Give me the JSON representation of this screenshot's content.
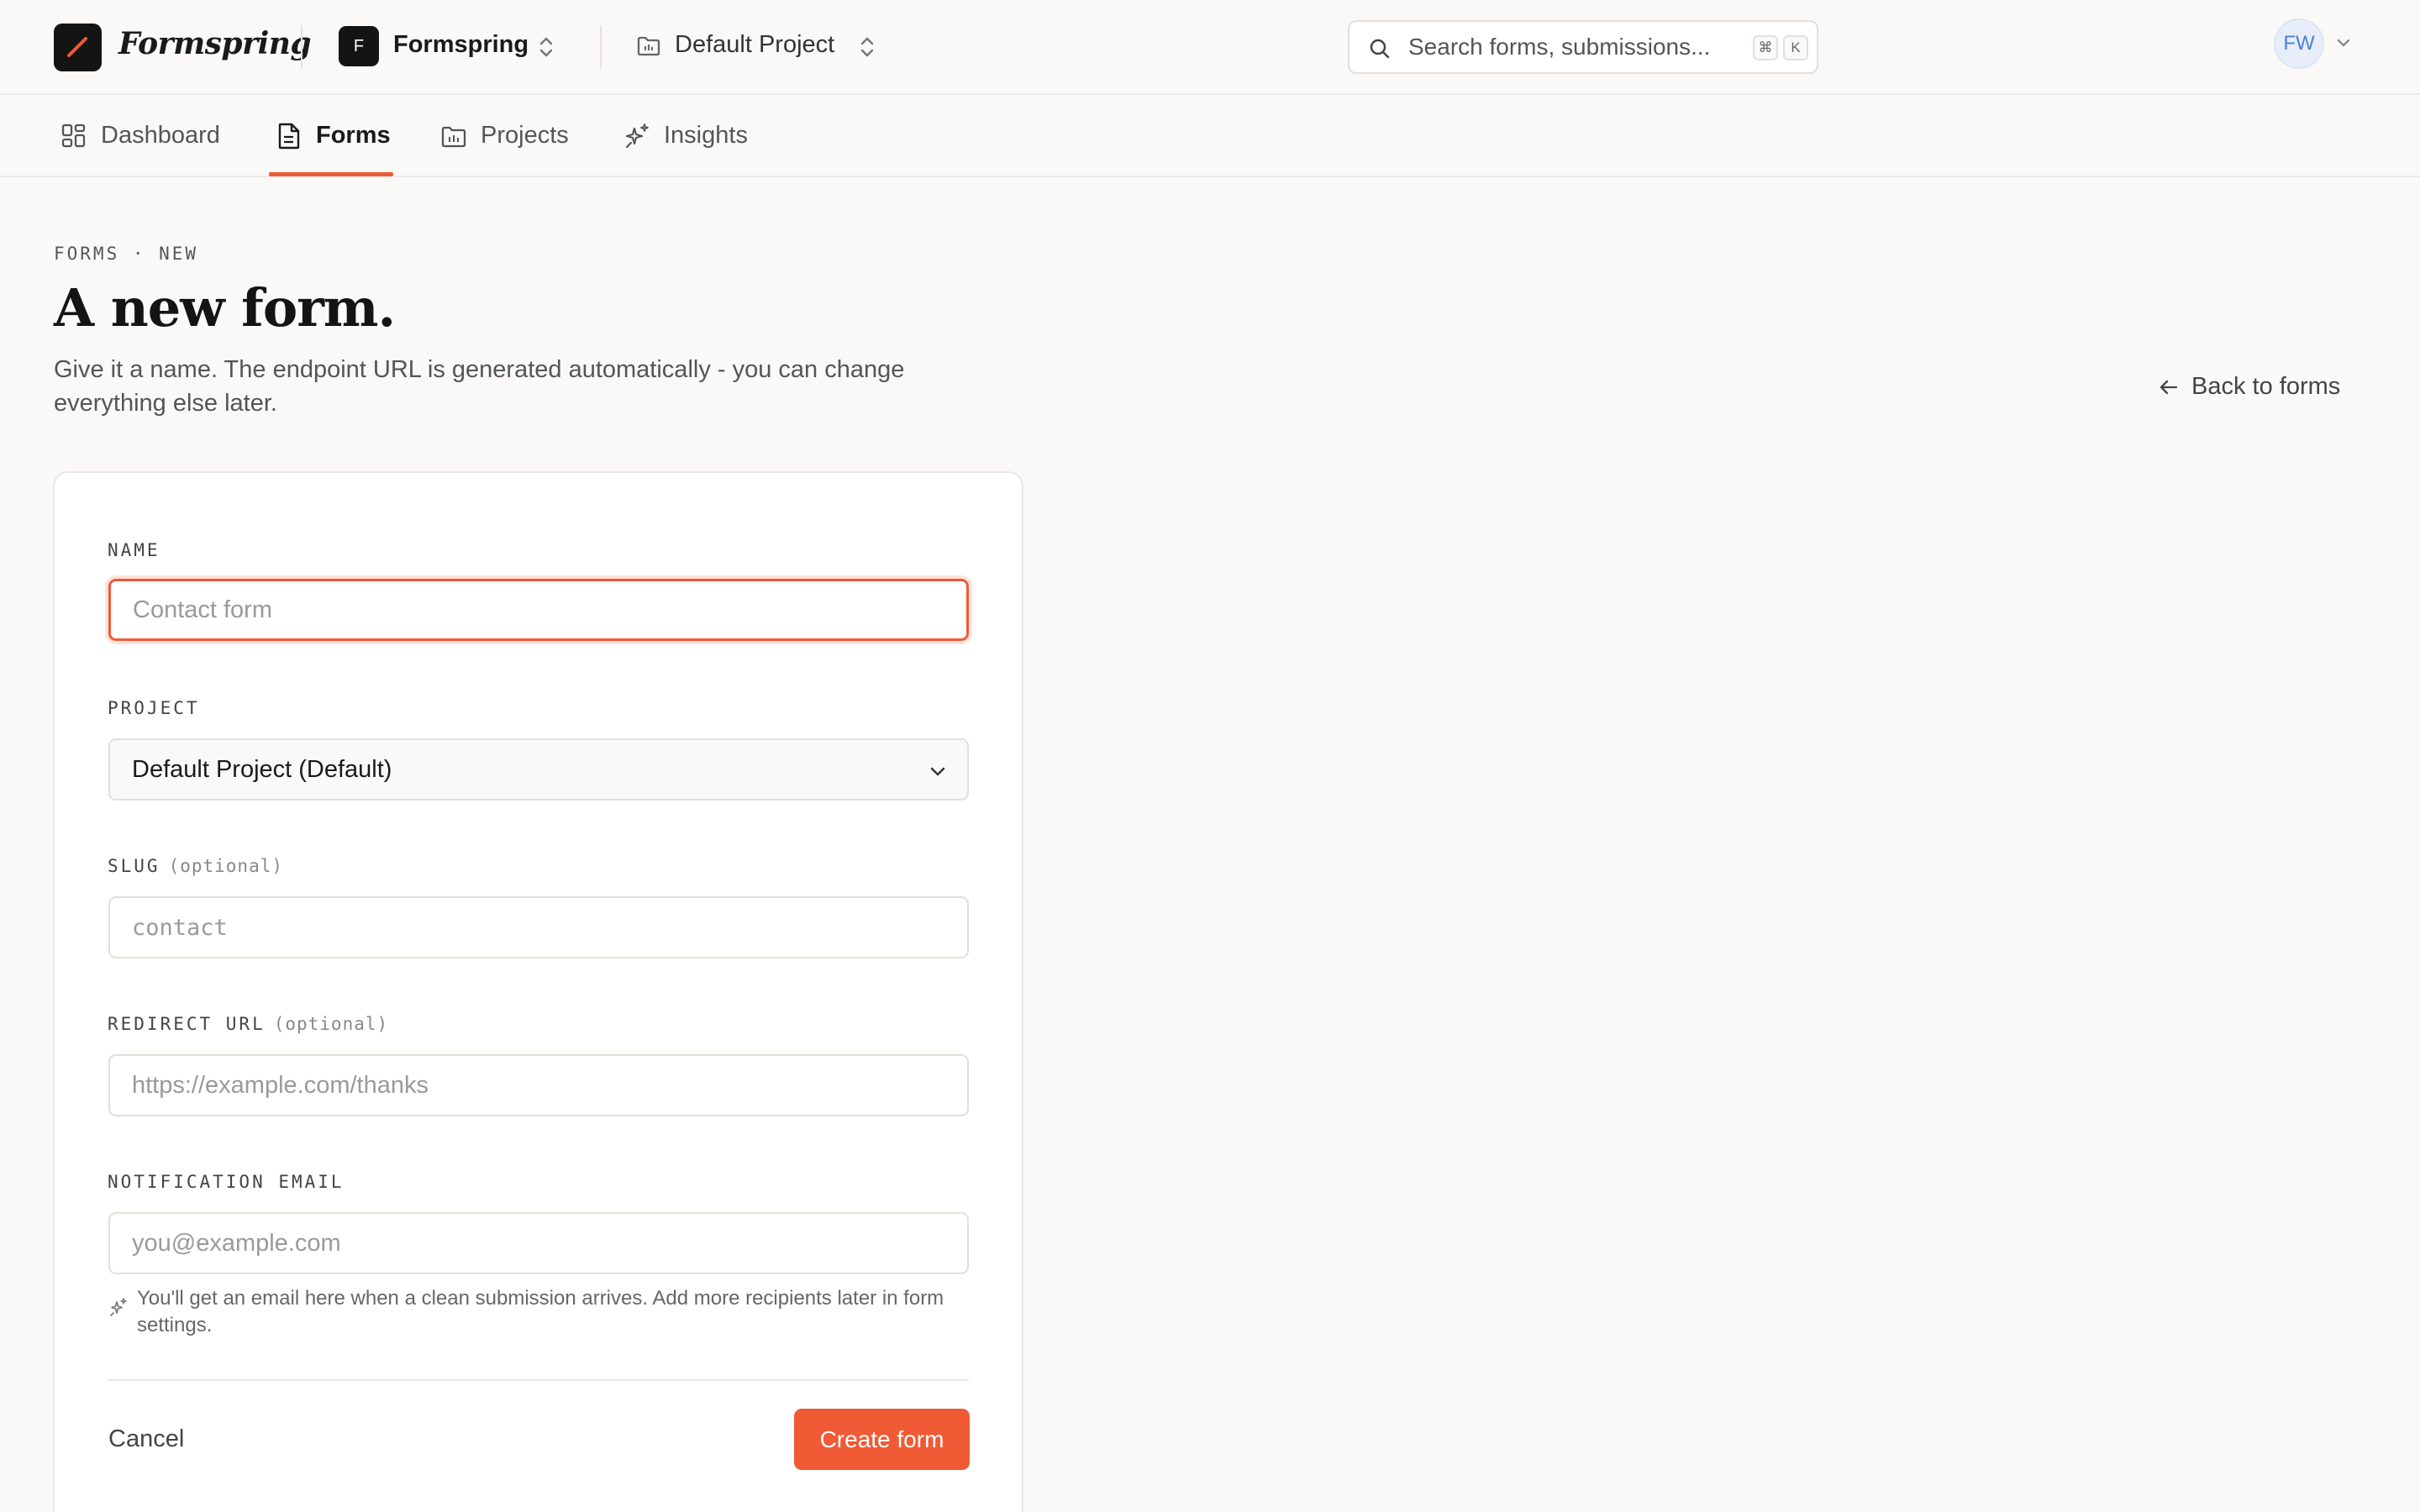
{
  "app": {
    "brand": "Formspring",
    "workspace_initial": "F",
    "workspace_name": "Formspring",
    "project_name": "Default Project"
  },
  "search": {
    "placeholder": "Search forms, submissions...",
    "shortcut_mod": "⌘",
    "shortcut_key": "K"
  },
  "user": {
    "initials": "FW"
  },
  "nav": {
    "tabs": [
      {
        "label": "Dashboard",
        "icon": "dashboard-icon",
        "active": false
      },
      {
        "label": "Forms",
        "icon": "document-icon",
        "active": true
      },
      {
        "label": "Projects",
        "icon": "folder-icon",
        "active": false
      },
      {
        "label": "Insights",
        "icon": "sparkles-icon",
        "active": false
      }
    ]
  },
  "header": {
    "eyebrow": "FORMS · NEW",
    "title": "A new form.",
    "subtitle": "Give it a name. The endpoint URL is generated automatically - you can change everything else later.",
    "back_label": "Back to forms"
  },
  "form": {
    "name": {
      "label": "NAME",
      "placeholder": "Contact form",
      "value": ""
    },
    "project": {
      "label": "PROJECT",
      "value": "Default Project (Default)"
    },
    "slug": {
      "label": "SLUG",
      "optional": "(optional)",
      "placeholder": "contact",
      "value": ""
    },
    "redirect": {
      "label": "REDIRECT URL",
      "optional": "(optional)",
      "placeholder": "https://example.com/thanks",
      "value": ""
    },
    "email": {
      "label": "NOTIFICATION EMAIL",
      "placeholder": "you@example.com",
      "value": "",
      "hint": "You'll get an email here when a clean submission arrives. Add more recipients later in form settings."
    },
    "cancel_label": "Cancel",
    "submit_label": "Create form"
  },
  "colors": {
    "accent": "#f05a35",
    "background": "#faf9f7",
    "text": "#1a1a1a"
  }
}
